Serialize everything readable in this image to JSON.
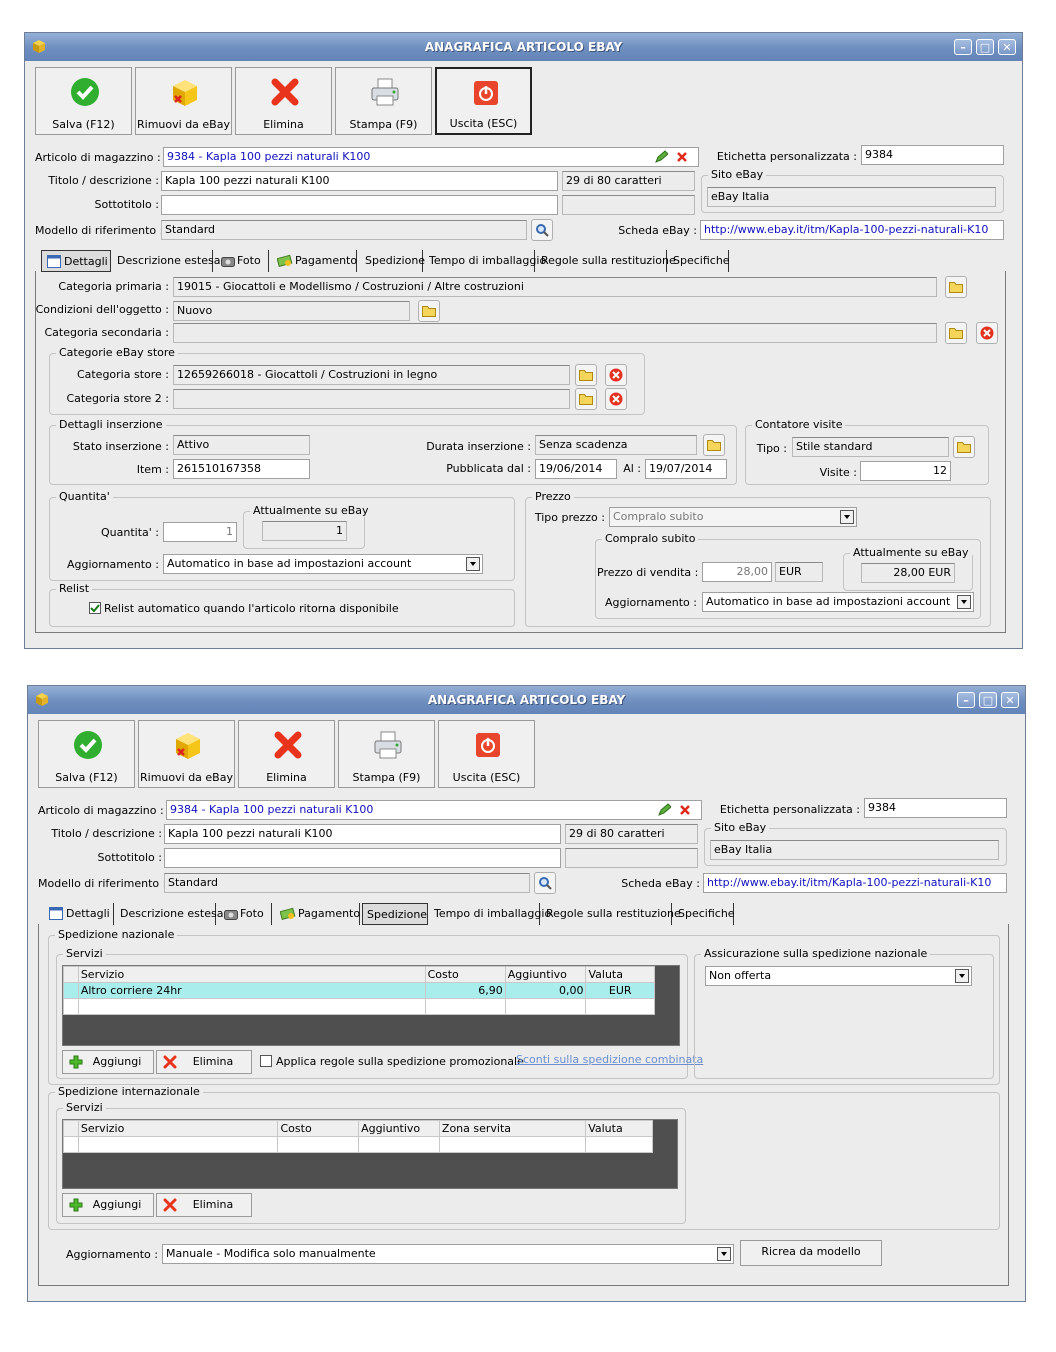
{
  "window1": {
    "title": "ANAGRAFICA ARTICOLO EBAY",
    "toolbar": {
      "save": "Salva (F12)",
      "remove": "Rimuovi da eBay",
      "delete": "Elimina",
      "print": "Stampa (F9)",
      "exit": "Uscita (ESC)"
    },
    "header": {
      "articolo_label": "Articolo di magazzino :",
      "articolo_value": "9384 - Kapla 100 pezzi naturali K100",
      "etichetta_label": "Etichetta personalizzata :",
      "etichetta_value": "9384",
      "titolo_label": "Titolo / descrizione :",
      "titolo_value": "Kapla 100 pezzi naturali K100",
      "char_count": "29 di 80 caratteri",
      "sito_label": "Sito eBay",
      "sito_value": "eBay Italia",
      "sottotitolo_label": "Sottotitolo :",
      "sottotitolo_value": "",
      "modello_label": "Modello di riferimento :",
      "modello_value": "Standard",
      "scheda_label": "Scheda eBay :",
      "scheda_value": "http://www.ebay.it/itm/Kapla-100-pezzi-naturali-K10"
    },
    "tabs": [
      "Dettagli",
      "Descrizione estesa",
      "Foto",
      "Pagamento",
      "Spedizione",
      "Tempo di imballaggio",
      "Regole sulla restituzione",
      "Specifiche"
    ],
    "selected_tab": "Dettagli",
    "dettagli": {
      "cat_primaria_label": "Categoria primaria :",
      "cat_primaria_value": "19015 - Giocattoli e Modellismo / Costruzioni / Altre costruzioni",
      "condizioni_label": "Condizioni dell'oggetto :",
      "condizioni_value": "Nuovo",
      "cat_secondaria_label": "Categoria secondaria :",
      "cat_secondaria_value": "",
      "store_group": "Categorie eBay store",
      "cat_store_label": "Categoria store :",
      "cat_store_value": "12659266018 - Giocattoli / Costruzioni in legno",
      "cat_store2_label": "Categoria store 2 :",
      "cat_store2_value": "",
      "inserzione_group": "Dettagli inserzione",
      "stato_label": "Stato inserzione :",
      "stato_value": "Attivo",
      "item_label": "Item :",
      "item_value": "261510167358",
      "durata_label": "Durata inserzione :",
      "durata_value": "Senza scadenza",
      "pubblicata_label": "Pubblicata dal :",
      "pubblicata_value": "19/06/2014",
      "al_label": "Al :",
      "al_value": "19/07/2014",
      "contatore_group": "Contatore visite",
      "tipo_label": "Tipo :",
      "tipo_value": "Stile standard",
      "visite_label": "Visite :",
      "visite_value": "12",
      "quantita_group": "Quantita'",
      "quantita_label": "Quantita' :",
      "quantita_value": "1",
      "attualmente_group": "Attualmente su eBay",
      "attualmente_value": "1",
      "aggiornamento_label": "Aggiornamento :",
      "aggiornamento_value": "Automatico in base ad impostazioni account",
      "relist_group": "Relist",
      "relist_text": "Relist automatico quando l'articolo ritorna disponibile",
      "prezzo_group": "Prezzo",
      "tipo_prezzo_label": "Tipo prezzo :",
      "tipo_prezzo_value": "Compralo subito",
      "compralo_group": "Compralo subito",
      "prezzo_vendita_label": "Prezzo di vendita :",
      "prezzo_vendita_value": "28,00",
      "valuta": "EUR",
      "attualmente_prezzo_group": "Attualmente su eBay",
      "attualmente_prezzo_value": "28,00 EUR",
      "aggiornamento_prezzo_label": "Aggiornamento :",
      "aggiornamento_prezzo_value": "Automatico in base ad impostazioni account"
    }
  },
  "window2": {
    "title": "ANAGRAFICA ARTICOLO EBAY",
    "selected_tab": "Spedizione",
    "spedizione": {
      "nazionale_group": "Spedizione nazionale",
      "servizi_group": "Servizi",
      "nazionale_columns": [
        "Servizio",
        "Costo",
        "Aggiuntivo",
        "Valuta"
      ],
      "nazionale_rows": [
        [
          "Altro corriere 24hr",
          "6,90",
          "0,00",
          "EUR"
        ]
      ],
      "aggiungi": "Aggiungi",
      "elimina": "Elimina",
      "promo_text": "Applica regole sulla spedizione promozionale",
      "sconti_link": "Sconti sulla spedizione combinata",
      "assicurazione_group": "Assicurazione sulla spedizione nazionale",
      "assicurazione_value": "Non offerta",
      "internazionale_group": "Spedizione internazionale",
      "internazionale_columns": [
        "Servizio",
        "Costo",
        "Aggiuntivo",
        "Zona servita",
        "Valuta"
      ],
      "aggiornamento_label": "Aggiornamento :",
      "aggiornamento_value": "Manuale - Modifica solo manualmente",
      "ricrea_button": "Ricrea da modello"
    }
  },
  "colors": {
    "titlebar": "#6e8ebf",
    "window_bg": "#ececec",
    "row_highlight": "#a9eeec",
    "link": "#6a8ed0"
  }
}
